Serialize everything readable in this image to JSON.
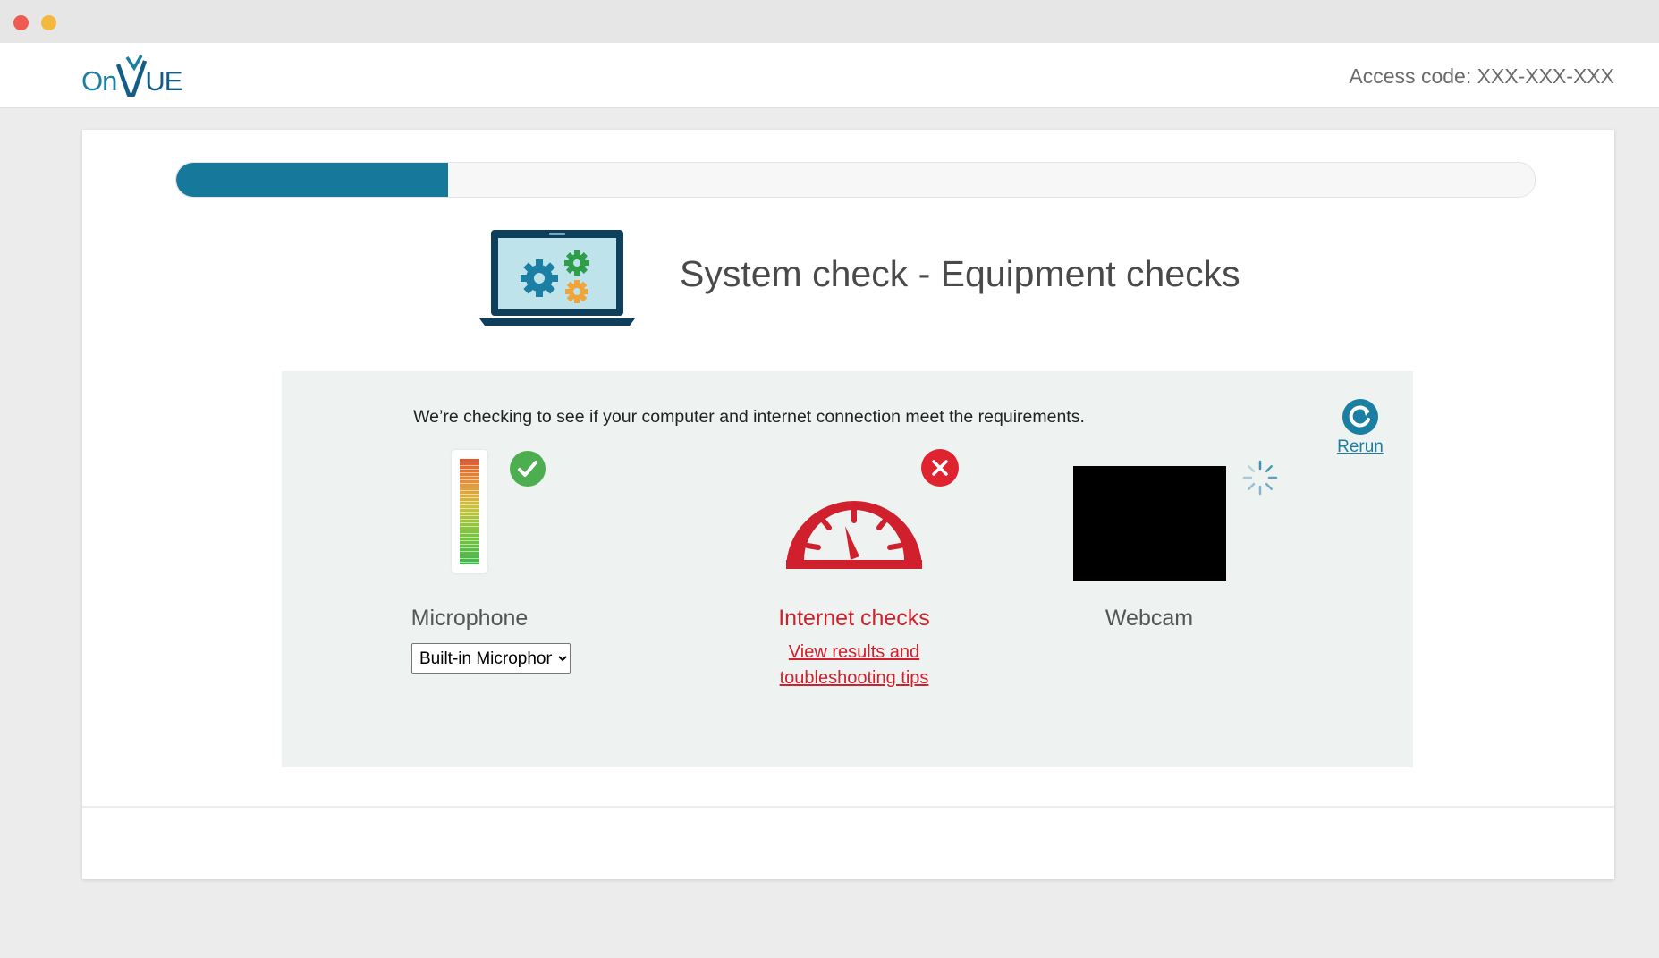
{
  "window": {
    "controls": [
      "close",
      "minimize"
    ]
  },
  "header": {
    "logo_on": "On",
    "logo_ue": "UE",
    "access_code": "Access code: XXX-XXX-XXX"
  },
  "progress": {
    "fraction": 0.2
  },
  "page": {
    "title": "System check - Equipment checks"
  },
  "panel": {
    "message": "We’re checking to see if your computer and internet connection meet the requirements.",
    "rerun_label": "Rerun",
    "microphone": {
      "label": "Microphone",
      "status": "passed",
      "selected_device": "Built-in Microphone"
    },
    "internet": {
      "label": "Internet checks",
      "status": "failed",
      "link_line1": "View results and",
      "link_line2": "toubleshooting tips"
    },
    "webcam": {
      "label": "Webcam",
      "status": "loading"
    }
  },
  "colors": {
    "brand": "#1b7fa3",
    "progress": "#16799b",
    "success": "#4cae4f",
    "error": "#d0202e"
  },
  "icons": [
    "laptop-gears-icon",
    "rerun-icon",
    "check-circle-icon",
    "error-x-icon",
    "speedometer-icon",
    "loading-spinner-icon"
  ]
}
